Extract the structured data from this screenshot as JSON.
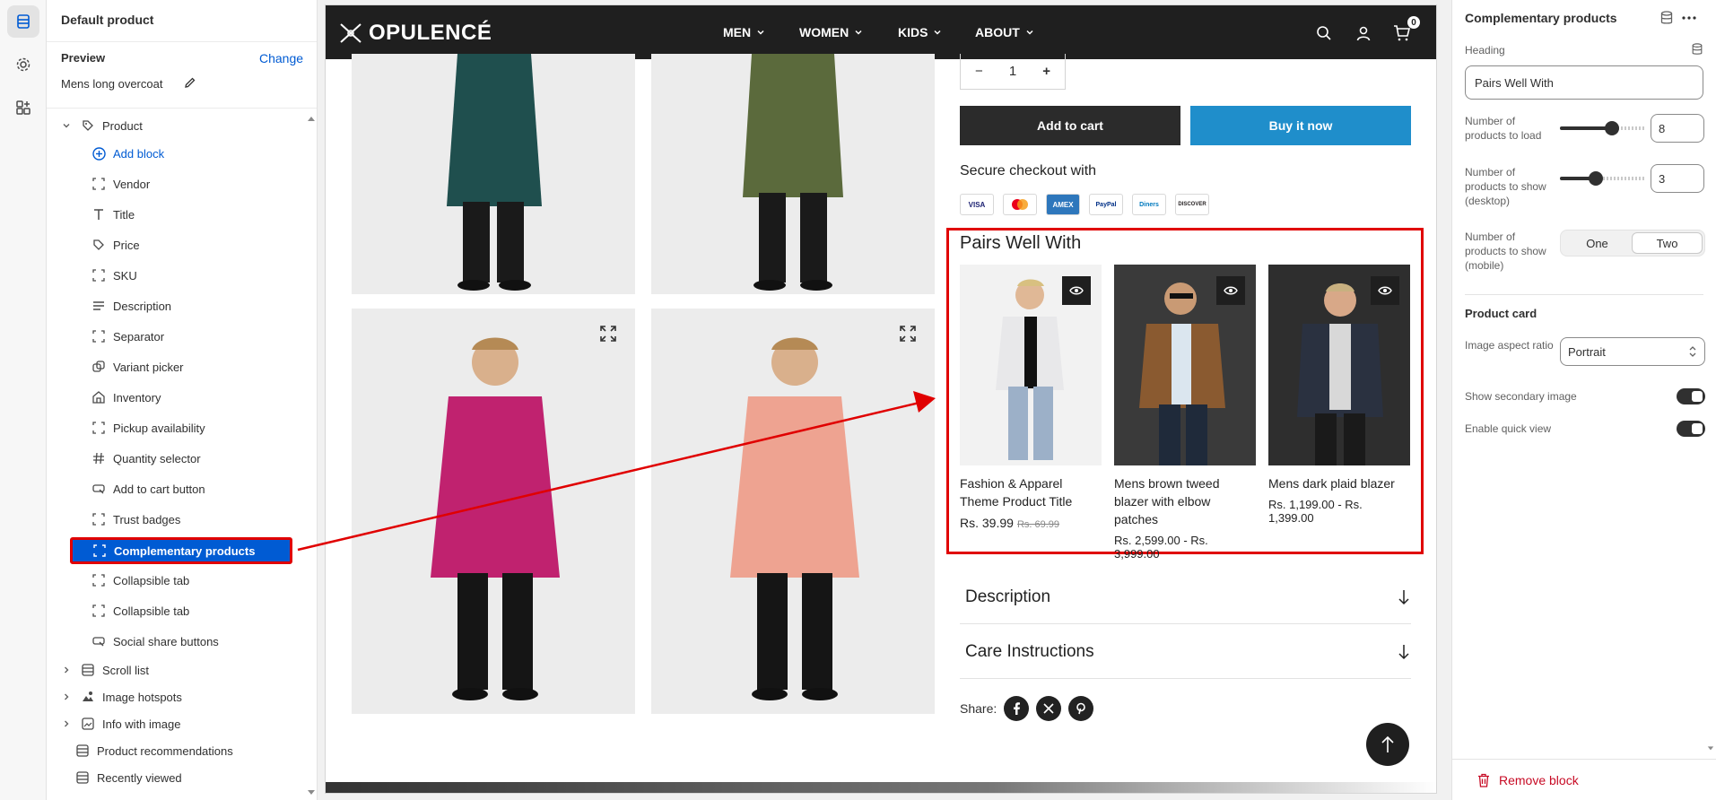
{
  "left_panel": {
    "title": "Default product",
    "preview_label": "Preview",
    "change_label": "Change",
    "preview_item": "Mens long overcoat",
    "product_section": "Product",
    "add_block": "Add block",
    "blocks": [
      "Vendor",
      "Title",
      "Price",
      "SKU",
      "Description",
      "Separator",
      "Variant picker",
      "Inventory",
      "Pickup availability",
      "Quantity selector",
      "Add to cart button",
      "Trust badges"
    ],
    "selected_block": "Complementary products",
    "blocks_after": [
      "Collapsible tab",
      "Collapsible tab",
      "Social share buttons"
    ],
    "sections": [
      "Scroll list",
      "Image hotspots",
      "Info with image",
      "Product recommendations",
      "Recently viewed"
    ]
  },
  "store": {
    "logo": "OPULENCÉ",
    "menu": [
      "MEN",
      "WOMEN",
      "KIDS",
      "ABOUT"
    ],
    "cart_count": "0",
    "quantity": "1",
    "add_to_cart": "Add to cart",
    "buy_now": "Buy it now",
    "secure_checkout": "Secure checkout with",
    "payments": [
      "VISA",
      "MC",
      "AMEX",
      "PayPal",
      "Diners",
      "DISCOVER"
    ],
    "pairs_heading": "Pairs Well With",
    "products": [
      {
        "name": "Fashion & Apparel Theme Product Title",
        "price": "Rs. 39.99",
        "old_price": "Rs. 69.99"
      },
      {
        "name": "Mens brown tweed blazer with elbow patches",
        "price": "Rs. 2,599.00 - Rs. 3,999.00",
        "old_price": ""
      },
      {
        "name": "Mens dark plaid blazer",
        "price": "Rs. 1,199.00 - Rs. 1,399.00",
        "old_price": ""
      }
    ],
    "accordions": [
      "Description",
      "Care Instructions"
    ],
    "share_label": "Share:"
  },
  "right_panel": {
    "title": "Complementary products",
    "heading_label": "Heading",
    "heading_value": "Pairs Well With",
    "load_label": "Number of products to load",
    "load_value": "8",
    "show_desktop_label": "Number of products to show (desktop)",
    "show_desktop_value": "3",
    "show_mobile_label": "Number of products to show (mobile)",
    "mobile_options": [
      "One",
      "Two"
    ],
    "product_card_label": "Product card",
    "aspect_label": "Image aspect ratio",
    "aspect_value": "Portrait",
    "secondary_label": "Show secondary image",
    "quickview_label": "Enable quick view",
    "remove_label": "Remove block"
  },
  "sliders": {
    "load_fraction": 0.63,
    "desktop_fraction": 0.4
  },
  "colors": {
    "accent": "#005bd3",
    "highlight": "#e00000",
    "buy": "#1f8ecb",
    "danger": "#c70a24"
  }
}
